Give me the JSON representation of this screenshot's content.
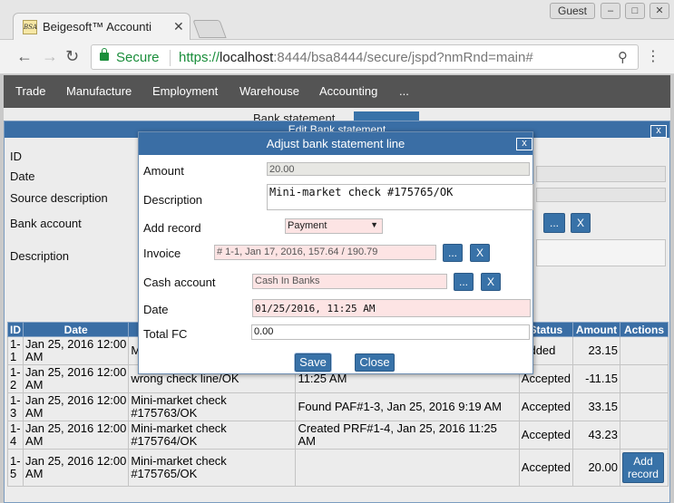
{
  "browser": {
    "tab_title": "Beigesoft™ Accounti",
    "tab_close": "✕",
    "favicon_text": "BSA",
    "guest_label": "Guest",
    "secure_label": "Secure",
    "url_scheme": "https://",
    "url_host": "localhost",
    "url_rest": ":8444/bsa8444/secure/jspd?nmRnd=main#"
  },
  "nav": {
    "items": [
      "Trade",
      "Manufacture",
      "Employment",
      "Warehouse",
      "Accounting",
      "..."
    ]
  },
  "behind": {
    "title": "Bank statement"
  },
  "edit_dialog": {
    "title": "Edit Bank statement",
    "labels": {
      "id": "ID",
      "date": "Date",
      "source": "Source description",
      "bank": "Bank account",
      "description": "Description"
    },
    "columns": [
      "ID",
      "Date",
      "",
      "",
      "Status",
      "Amount",
      "Actions"
    ],
    "rows": [
      {
        "id": "1-1",
        "date": "Jan 25, 2016 12:00 AM",
        "source": "Mi",
        "result": "",
        "status": "Added",
        "amount": "23.15"
      },
      {
        "id": "1-2",
        "date": "Jan 25, 2016 12:00 AM",
        "source": "wrong check line/OK",
        "result": "11:25 AM",
        "status": "Accepted",
        "amount": "-11.15"
      },
      {
        "id": "1-3",
        "date": "Jan 25, 2016 12:00 AM",
        "source": "Mini-market check #175763/OK",
        "result": "Found PAF#1-3, Jan 25, 2016 9:19 AM",
        "status": "Accepted",
        "amount": "33.15"
      },
      {
        "id": "1-4",
        "date": "Jan 25, 2016 12:00 AM",
        "source": "Mini-market check #175764/OK",
        "result": "Created PRF#1-4, Jan 25, 2016 11:25 AM",
        "status": "Accepted",
        "amount": "43.23"
      },
      {
        "id": "1-5",
        "date": "Jan 25, 2016 12:00 AM",
        "source": "Mini-market check #175765/OK",
        "result": "",
        "status": "Accepted",
        "amount": "20.00",
        "action": "Add record"
      }
    ]
  },
  "modal": {
    "title": "Adjust bank statement line",
    "close": "x",
    "labels": {
      "amount": "Amount",
      "description": "Description",
      "add_record": "Add record",
      "invoice": "Invoice",
      "cash_account": "Cash account",
      "date": "Date",
      "total_fc": "Total FC"
    },
    "values": {
      "amount": "20.00",
      "description": "Mini-market check #175765/OK",
      "add_record": "Payment",
      "invoice": "# 1-1, Jan 17, 2016, 157.64 / 190.79",
      "cash_account": "Cash In Banks",
      "date": "01/25/2016, 11:25 AM",
      "total_fc": "0.00"
    },
    "pick_label": "...",
    "clear_label": "X",
    "save": "Save",
    "close_button": "Close"
  }
}
